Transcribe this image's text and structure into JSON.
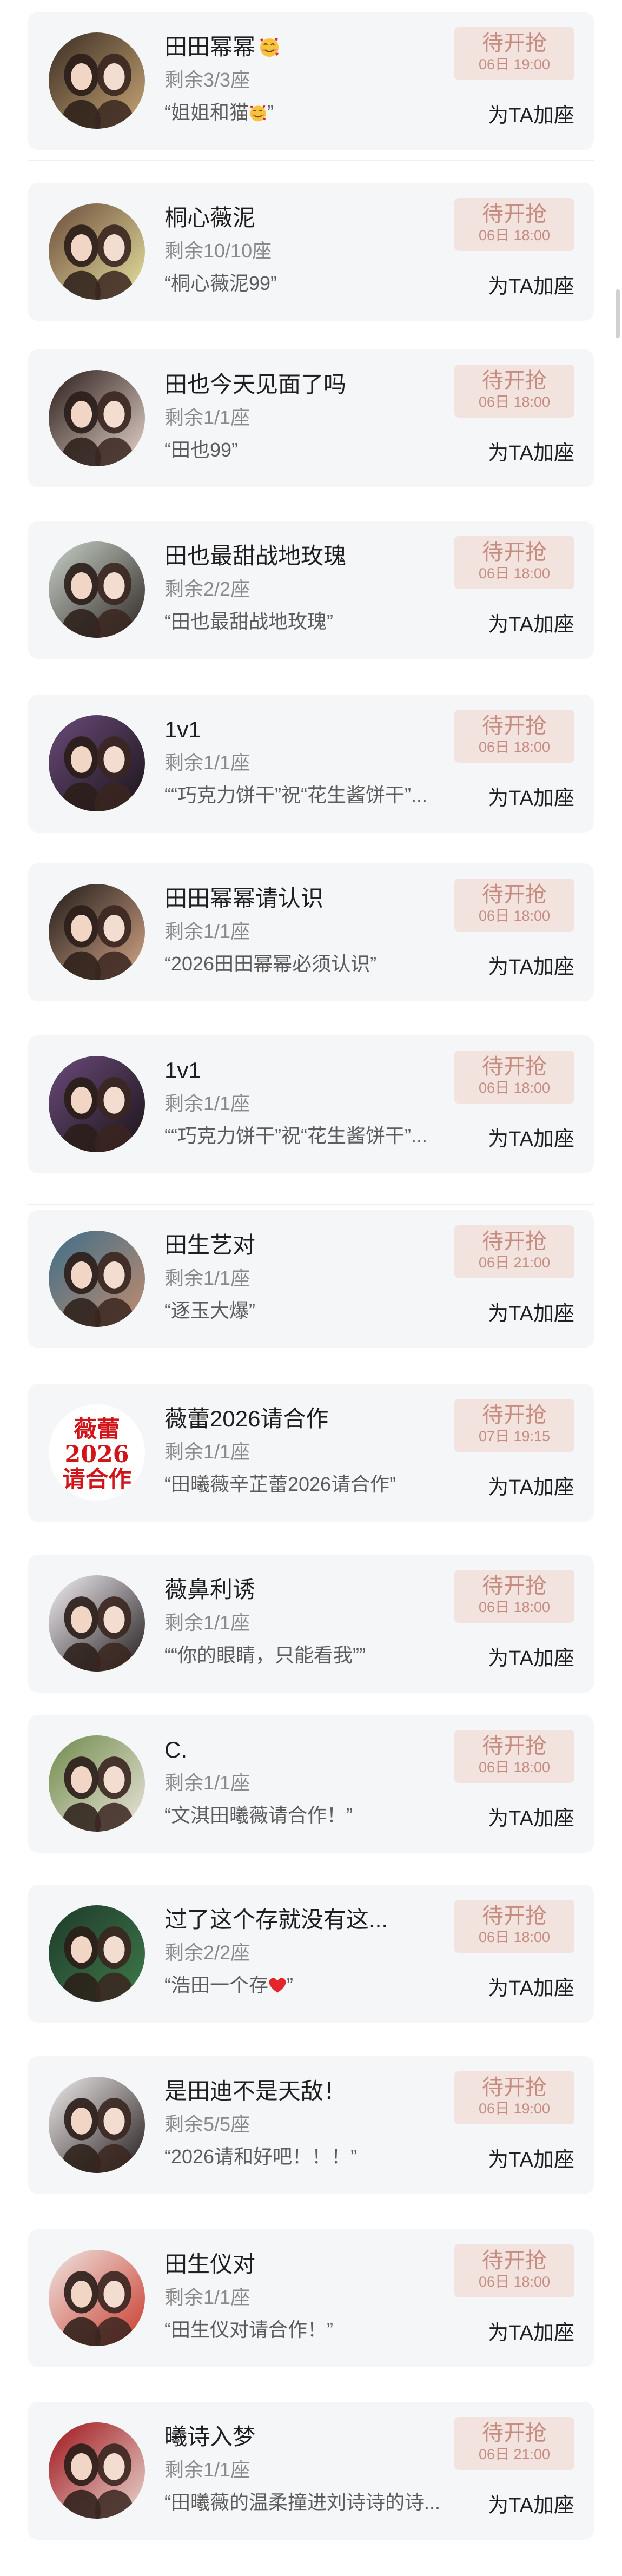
{
  "list": {
    "items": [
      {
        "name": "田田幂幂",
        "name_emoji": "smiling-face-with-hearts-icon",
        "seats": "剩余3/3座",
        "quote": "“姐姐和猫",
        "quote_emoji_tail": "”",
        "quote_emoji": "smiling-face-with-hearts-icon",
        "status": "待开抢",
        "time": "06日 19:00",
        "action": "为TA加座",
        "avatar_colors": [
          "#3a2c22",
          "#c9a877"
        ]
      },
      {
        "name": "桐心薇泥",
        "seats": "剩余10/10座",
        "quote": "“桐心薇泥99”",
        "status": "待开抢",
        "time": "06日 18:00",
        "action": "为TA加座",
        "avatar_colors": [
          "#6b4a3a",
          "#e8e4a0"
        ]
      },
      {
        "name": "田也今天见面了吗",
        "seats": "剩余1/1座",
        "quote": "“田也99”",
        "status": "待开抢",
        "time": "06日 18:00",
        "action": "为TA加座",
        "avatar_colors": [
          "#2b1c18",
          "#e7d6cf"
        ]
      },
      {
        "name": "田也最甜战地玫瑰",
        "seats": "剩余2/2座",
        "quote": "“田也最甜战地玫瑰”",
        "status": "待开抢",
        "time": "06日 18:00",
        "action": "为TA加座",
        "avatar_colors": [
          "#c8d2c9",
          "#2e2622"
        ]
      },
      {
        "name": "1v1",
        "seats": "剩余1/1座",
        "quote": "““巧克力饼干”祝“花生酱饼干”...",
        "status": "待开抢",
        "time": "06日 18:00",
        "action": "为TA加座",
        "avatar_colors": [
          "#6a4a7a",
          "#1a1418"
        ]
      },
      {
        "name": "田田幂幂请认识",
        "seats": "剩余1/1座",
        "quote": "“2026田田幂幂必须认识”",
        "status": "待开抢",
        "time": "06日 18:00",
        "action": "为TA加座",
        "avatar_colors": [
          "#1f1a18",
          "#d6a789"
        ]
      },
      {
        "name": "1v1",
        "seats": "剩余1/1座",
        "quote": "““巧克力饼干”祝“花生酱饼干”...",
        "status": "待开抢",
        "time": "06日 18:00",
        "action": "为TA加座",
        "avatar_colors": [
          "#6a4a7a",
          "#1a1418"
        ]
      },
      {
        "name": "田生艺对",
        "seats": "剩余1/1座",
        "quote": "“逐玉大爆”",
        "status": "待开抢",
        "time": "06日 21:00",
        "action": "为TA加座",
        "avatar_colors": [
          "#3d6e8a",
          "#c28c6e"
        ]
      },
      {
        "name": "薇蕾2026请合作",
        "seats": "剩余1/1座",
        "quote": "“田曦薇辛芷蕾2026请合作”",
        "status": "待开抢",
        "time": "07日 19:15",
        "action": "为TA加座",
        "avatar_text": "薇蕾 2026 请合作",
        "avatar_colors": [
          "#ffffff",
          "#d0141a"
        ]
      },
      {
        "name": "薇鼻利诱",
        "seats": "剩余1/1座",
        "quote": "““你的眼睛，只能看我””",
        "status": "待开抢",
        "time": "06日 18:00",
        "action": "为TA加座",
        "avatar_colors": [
          "#f4f0f4",
          "#201a1c"
        ]
      },
      {
        "name": "C.",
        "seats": "剩余1/1座",
        "quote": "“文淇田曦薇请合作！”",
        "status": "待开抢",
        "time": "06日 18:00",
        "action": "为TA加座",
        "avatar_colors": [
          "#6f8a4a",
          "#ece6dc"
        ]
      },
      {
        "name": "过了这个存就没有这...",
        "seats": "剩余2/2座",
        "quote": "“浩田一个存",
        "quote_emoji_tail": "”",
        "quote_emoji": "red-heart-icon",
        "status": "待开抢",
        "time": "06日 18:00",
        "action": "为TA加座",
        "avatar_colors": [
          "#1f3a2a",
          "#3e7a4a"
        ]
      },
      {
        "name": "是田迪不是天敌！",
        "seats": "剩余5/5座",
        "quote": "“2026请和好吧！！！”",
        "status": "待开抢",
        "time": "06日 19:00",
        "action": "为TA加座",
        "avatar_colors": [
          "#f0ecec",
          "#241c1c"
        ]
      },
      {
        "name": "田生仪对",
        "seats": "剩余1/1座",
        "quote": "“田生仪对请合作！”",
        "status": "待开抢",
        "time": "06日 18:00",
        "action": "为TA加座",
        "avatar_colors": [
          "#efe6e2",
          "#c93a2c"
        ]
      },
      {
        "name": "曦诗入梦",
        "seats": "剩余1/1座",
        "quote": "“田曦薇的温柔撞进刘诗诗的诗...",
        "status": "待开抢",
        "time": "06日 21:00",
        "action": "为TA加座",
        "avatar_colors": [
          "#a0141a",
          "#e8d8d2"
        ]
      }
    ]
  }
}
